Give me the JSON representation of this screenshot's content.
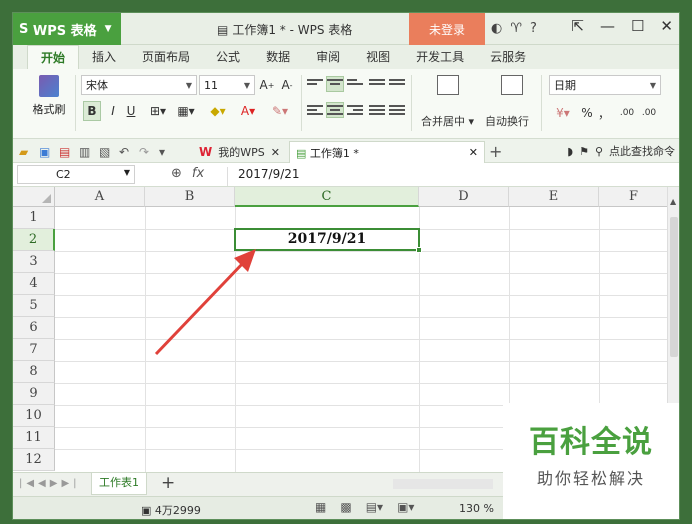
{
  "app": {
    "name": "WPS 表格",
    "doc_title": "工作簿1 * - WPS 表格",
    "login": "未登录",
    "help": "?"
  },
  "ribbon_tabs": [
    "开始",
    "插入",
    "页面布局",
    "公式",
    "数据",
    "审阅",
    "视图",
    "开发工具",
    "云服务"
  ],
  "ribbon": {
    "format_painter": "格式刷",
    "font_name": "宋体",
    "font_size": "11",
    "bold": "B",
    "italic": "I",
    "underline": "U",
    "merge_center": "合并居中",
    "wrap_text": "自动换行",
    "number_format": "日期",
    "percent": "%",
    "thousands": "，",
    "dec_inc": ".00",
    "dec_dec": ".00"
  },
  "doctabs": {
    "wps": "我的WPS",
    "book": "工作簿1 *",
    "find": "点此查找命令"
  },
  "formula_bar": {
    "name_box": "C2",
    "fx": "fx",
    "content": "2017/9/21"
  },
  "columns": [
    "A",
    "B",
    "C",
    "D",
    "E",
    "F"
  ],
  "rows": [
    "1",
    "2",
    "3",
    "4",
    "5",
    "6",
    "7",
    "8",
    "9",
    "10",
    "11",
    "12"
  ],
  "active_cell": {
    "ref": "C2",
    "value": "2017/9/21"
  },
  "sheets": [
    "工作表1"
  ],
  "status": {
    "count": "4万2999",
    "zoom": "130 %"
  },
  "watermark": {
    "title": "百科全说",
    "subtitle": "助你轻松解决"
  },
  "colors": {
    "accent": "#4aa03f",
    "login_bg": "#ea7e5c",
    "arrow": "#e0413a"
  }
}
